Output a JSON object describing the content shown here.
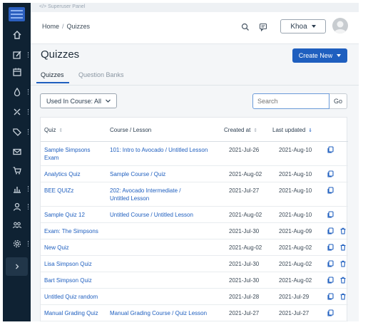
{
  "supertop": {
    "label": "</> Superuser Panel"
  },
  "breadcrumb": {
    "home": "Home",
    "separator": "/",
    "current": "Quizzes"
  },
  "user": {
    "name": "Khoa"
  },
  "page": {
    "title": "Quizzes",
    "create_label": "Create New"
  },
  "tabs": [
    {
      "label": "Quizzes",
      "active": true
    },
    {
      "label": "Question Banks",
      "active": false
    }
  ],
  "filter": {
    "label": "Used In Course: All"
  },
  "search": {
    "placeholder": "Search",
    "go_label": "Go"
  },
  "table": {
    "columns": {
      "quiz": "Quiz",
      "course": "Course / Lesson",
      "created": "Created at",
      "updated": "Last updated"
    },
    "rows": [
      {
        "quiz": "Sample Simpsons",
        "quiz2": "Exam",
        "course": "101: Intro to Avocado / Untitled Lesson",
        "course2": "",
        "created": "2021-Jul-26",
        "updated": "2021-Aug-10",
        "delete": false
      },
      {
        "quiz": "Analytics Quiz",
        "quiz2": "",
        "course": "Sample Course / Quiz",
        "course2": "",
        "created": "2021-Aug-02",
        "updated": "2021-Aug-10",
        "delete": false
      },
      {
        "quiz": "BEE QUIZz",
        "quiz2": "",
        "course": "202: Avocado Intermediate /",
        "course2": "Untitled Lesson",
        "created": "2021-Jul-27",
        "updated": "2021-Aug-10",
        "delete": false
      },
      {
        "quiz": "Sample Quiz 12",
        "quiz2": "",
        "course": "Untitled Course / Untitled Lesson",
        "course2": "",
        "created": "2021-Aug-02",
        "updated": "2021-Aug-10",
        "delete": false
      },
      {
        "quiz": "Exam: The Simpsons",
        "quiz2": "",
        "course": "",
        "course2": "",
        "created": "2021-Jul-30",
        "updated": "2021-Aug-09",
        "delete": true
      },
      {
        "quiz": "New Quiz",
        "quiz2": "",
        "course": "",
        "course2": "",
        "created": "2021-Aug-02",
        "updated": "2021-Aug-02",
        "delete": true
      },
      {
        "quiz": "Lisa Simpson Quiz",
        "quiz2": "",
        "course": "",
        "course2": "",
        "created": "2021-Jul-30",
        "updated": "2021-Aug-02",
        "delete": true
      },
      {
        "quiz": "Bart Simpson Quiz",
        "quiz2": "",
        "course": "",
        "course2": "",
        "created": "2021-Jul-30",
        "updated": "2021-Aug-02",
        "delete": true
      },
      {
        "quiz": "Untitled Quiz random",
        "quiz2": "",
        "course": "",
        "course2": "",
        "created": "2021-Jul-28",
        "updated": "2021-Jul-29",
        "delete": true
      },
      {
        "quiz": "Manual Grading Quiz",
        "quiz2": "",
        "course": "Manual Grading Course / Quiz Lesson",
        "course2": "",
        "created": "2021-Jul-27",
        "updated": "2021-Jul-27",
        "delete": false
      }
    ]
  },
  "colors": {
    "sidebar": "#0f2233",
    "accent": "#1f5fbf",
    "link": "#1f5fbf"
  },
  "sidebar_icons": [
    "home-icon",
    "edit-icon",
    "calendar-icon",
    "drop-icon",
    "tools-icon",
    "tag-icon",
    "mail-icon",
    "cart-icon",
    "chart-icon",
    "user-icon",
    "users-icon",
    "gear-icon",
    "chevron-right-icon"
  ]
}
